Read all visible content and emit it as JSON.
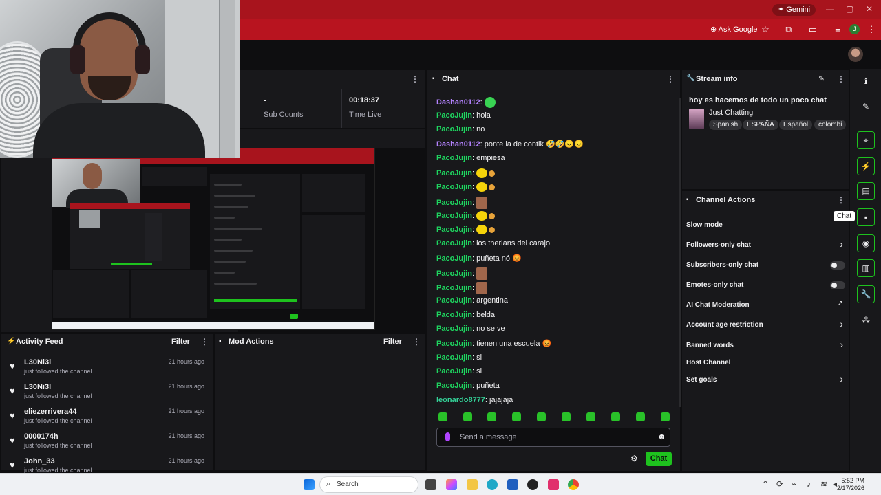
{
  "browser": {
    "gemini_label": "Gemini",
    "ask_google_label": "Ask Google",
    "profile_initial": "J"
  },
  "stats": {
    "sub_value": "-",
    "sub_label": "Sub Counts",
    "time_value": "00:18:37",
    "time_label": "Time Live"
  },
  "activity": {
    "title": "Activity Feed",
    "filter": "Filter",
    "items": [
      {
        "name": "L30Ni3l",
        "action": "just followed the channel",
        "time": "21 hours ago"
      },
      {
        "name": "L30Ni3l",
        "action": "just followed the channel",
        "time": "21 hours ago"
      },
      {
        "name": "eliezerrivera44",
        "action": "just followed the channel",
        "time": "21 hours ago"
      },
      {
        "name": "0000174h",
        "action": "just followed the channel",
        "time": "21 hours ago"
      },
      {
        "name": "John_33",
        "action": "just followed the channel",
        "time": "21 hours ago"
      }
    ]
  },
  "mod_actions": {
    "title": "Mod Actions",
    "filter": "Filter"
  },
  "chat": {
    "title": "Chat",
    "messages": [
      {
        "user": "Dashan0112",
        "text": "",
        "emote": "green",
        "color": "purple"
      },
      {
        "user": "PacoJujin",
        "text": "hola",
        "emote": "",
        "color": "green"
      },
      {
        "user": "PacoJujin",
        "text": "no",
        "emote": "",
        "color": "green"
      },
      {
        "user": "Dashan0112",
        "text": "ponte la de contik 🤣🤣😠😠",
        "emote": "",
        "color": "purple"
      },
      {
        "user": "PacoJujin",
        "text": "empiesa",
        "emote": "",
        "color": "green"
      },
      {
        "user": "PacoJujin",
        "text": "",
        "emote": "yellow",
        "color": "green"
      },
      {
        "user": "PacoJujin",
        "text": "",
        "emote": "yellow",
        "color": "green"
      },
      {
        "user": "PacoJujin",
        "text": "",
        "emote": "face",
        "color": "green"
      },
      {
        "user": "PacoJujin",
        "text": "",
        "emote": "yellow",
        "color": "green"
      },
      {
        "user": "PacoJujin",
        "text": "",
        "emote": "yellow",
        "color": "green"
      },
      {
        "user": "PacoJujin",
        "text": "los therians del carajo",
        "emote": "",
        "color": "green"
      },
      {
        "user": "PacoJujin",
        "text": "puñeta nó 😡",
        "emote": "",
        "color": "green"
      },
      {
        "user": "PacoJujin",
        "text": "",
        "emote": "face",
        "color": "green"
      },
      {
        "user": "PacoJujin",
        "text": "",
        "emote": "face",
        "color": "green"
      },
      {
        "user": "PacoJujin",
        "text": "argentina",
        "emote": "",
        "color": "green"
      },
      {
        "user": "PacoJujin",
        "text": "belda",
        "emote": "",
        "color": "green"
      },
      {
        "user": "PacoJujin",
        "text": "no se ve",
        "emote": "",
        "color": "green"
      },
      {
        "user": "PacoJujin",
        "text": "tienen una escuela 😡",
        "emote": "",
        "color": "green"
      },
      {
        "user": "PacoJujin",
        "text": "si",
        "emote": "",
        "color": "green"
      },
      {
        "user": "PacoJujin",
        "text": "si",
        "emote": "",
        "color": "green"
      },
      {
        "user": "PacoJujin",
        "text": "puñeta",
        "emote": "",
        "color": "green"
      },
      {
        "user": "leonardo8777",
        "text": "jajajaja",
        "emote": "",
        "color": "teal"
      }
    ],
    "input_placeholder": "Send a message",
    "send_label": "Chat"
  },
  "stream_info": {
    "title": "Stream info",
    "stream_title": "hoy es hacemos de todo un poco chat",
    "category": "Just Chatting",
    "tags": [
      "Spanish",
      "ESPAÑA",
      "Español",
      "colombi"
    ]
  },
  "channel_actions": {
    "title": "Channel Actions",
    "items": [
      {
        "label": "Slow mode",
        "control": "none"
      },
      {
        "label": "Followers-only chat",
        "control": "chevron"
      },
      {
        "label": "Subscribers-only chat",
        "control": "toggle"
      },
      {
        "label": "Emotes-only chat",
        "control": "toggle"
      },
      {
        "label": "AI Chat Moderation",
        "control": "external"
      },
      {
        "label": "Account age restriction",
        "control": "chevron"
      },
      {
        "label": "Banned words",
        "control": "chevron"
      },
      {
        "label": "Host Channel",
        "control": "none"
      },
      {
        "label": "Set goals",
        "control": "chevron"
      }
    ]
  },
  "rightbar": {
    "tooltip": "Chat",
    "icons": [
      "info-icon",
      "pencil-icon",
      "clip-icon",
      "bolt-icon",
      "notes-icon",
      "chat-icon",
      "broadcast-icon",
      "layout-icon",
      "wrench-icon",
      "share-icon"
    ]
  },
  "taskbar": {
    "search_label": "Search",
    "time": "5:52 PM",
    "date": "2/17/2026"
  },
  "colors": {
    "accent": "#1ec21e",
    "browser_red": "#b8141f",
    "panel": "#18181b",
    "background": "#0e0e10"
  }
}
